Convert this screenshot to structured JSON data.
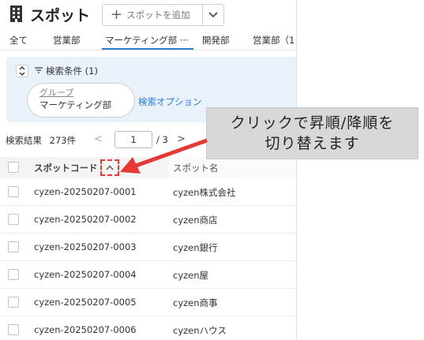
{
  "header": {
    "title": "スポット",
    "add_button_label": "スポットを追加"
  },
  "tabs": [
    {
      "label": "全て"
    },
    {
      "label": "営業部"
    },
    {
      "label": "マーケティング部 ···"
    },
    {
      "label": "開発部"
    },
    {
      "label": "営業部（1"
    }
  ],
  "search": {
    "label": "検索条件 (1)",
    "chip_key": "グループ",
    "chip_value": "マーケティング部",
    "options_link": "検索オプション"
  },
  "pagination": {
    "results_label": "検索結果",
    "count": "273件",
    "prev": "<",
    "current_page": "1",
    "total": "/ 3",
    "next": ">"
  },
  "table": {
    "columns": [
      "スポットコード",
      "スポット名"
    ],
    "rows": [
      {
        "code": "cyzen-20250207-0001",
        "name": "cyzen株式会社"
      },
      {
        "code": "cyzen-20250207-0002",
        "name": "cyzen商店"
      },
      {
        "code": "cyzen-20250207-0003",
        "name": "cyzen銀行"
      },
      {
        "code": "cyzen-20250207-0004",
        "name": "cyzen屋"
      },
      {
        "code": "cyzen-20250207-0005",
        "name": "cyzen商事"
      },
      {
        "code": "cyzen-20250207-0006",
        "name": "cyzenハウス"
      }
    ]
  },
  "annotation": {
    "line1": "クリックで昇順/降順を",
    "line2": "切り替えます",
    "color": "#e53935"
  },
  "colors": {
    "accent": "#2e7bd6",
    "search_bg": "#e9f2fb"
  }
}
